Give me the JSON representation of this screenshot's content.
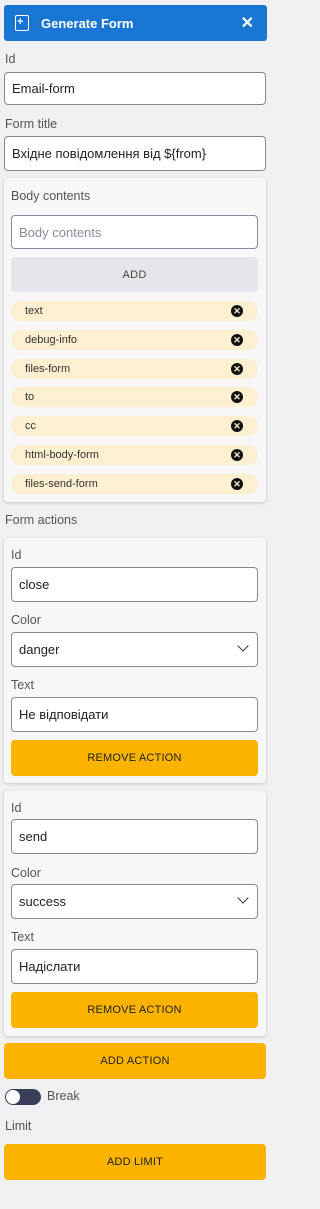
{
  "header": {
    "title": "Generate Form",
    "close_icon": "close-icon"
  },
  "id_field": {
    "label": "Id",
    "value": "Email-form"
  },
  "form_title": {
    "label": "Form title",
    "value": "Вхідне повідомлення від ${from}"
  },
  "body_contents": {
    "label": "Body contents",
    "placeholder": "Body contents",
    "add_label": "ADD",
    "chips": [
      "text",
      "debug-info",
      "files-form",
      "to",
      "cc",
      "html-body-form",
      "files-send-form"
    ]
  },
  "form_actions": {
    "label": "Form actions",
    "actions": [
      {
        "id_label": "Id",
        "id": "close",
        "color_label": "Color",
        "color": "danger",
        "text_label": "Text",
        "text": "Не відповідати",
        "remove_label": "REMOVE ACTION"
      },
      {
        "id_label": "Id",
        "id": "send",
        "color_label": "Color",
        "color": "success",
        "text_label": "Text",
        "text": "Надіслати",
        "remove_label": "REMOVE ACTION"
      }
    ],
    "add_action_label": "ADD ACTION"
  },
  "break_toggle": {
    "label": "Break",
    "on": false
  },
  "limit": {
    "label": "Limit",
    "add_limit_label": "ADD LIMIT"
  },
  "colors": {
    "header": "#1976d2",
    "accent": "#fbb300",
    "chip": "#fdf0d0"
  }
}
